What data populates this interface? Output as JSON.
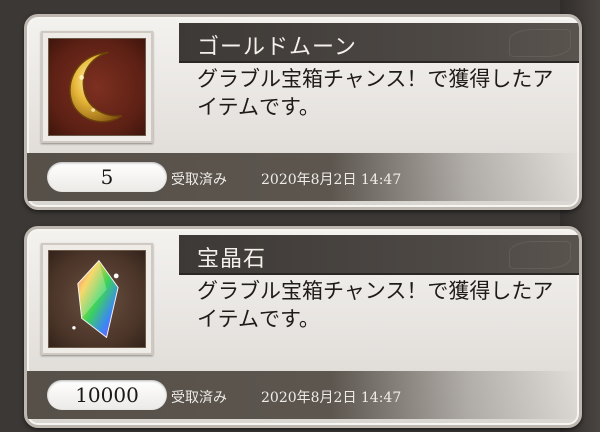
{
  "items": [
    {
      "name": "ゴールドムーン",
      "description": "グラブル宝箱チャンス！で獲得したアイテムです。",
      "count": "5",
      "status": "受取済み",
      "date": "2020年8月2日 14:47",
      "icon": "gold-moon-icon"
    },
    {
      "name": "宝晶石",
      "description": "グラブル宝箱チャンス！で獲得したアイテムです。",
      "count": "10000",
      "status": "受取済み",
      "date": "2020年8月2日 14:47",
      "icon": "crystal-icon"
    }
  ],
  "colors": {
    "title_band": "#4a4541",
    "card_bg": "#ecebe8",
    "page_bg": "#3b3836"
  }
}
